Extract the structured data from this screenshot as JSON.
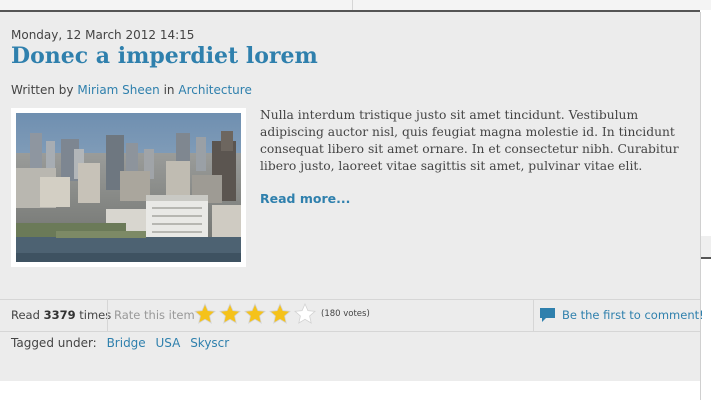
{
  "article": {
    "date": "Monday, 12 March 2012 14:15",
    "title": "Donec a imperdiet lorem",
    "written_by_label": "Written by",
    "author": "Miriam Sheen",
    "in_label": "in",
    "category": "Architecture",
    "intro": "Nulla interdum tristique justo sit amet tincidunt. Vestibulum adipiscing auctor nisl, quis feugiat magna molestie id. In tincidunt consequat libero sit amet ornare. In et consectetur nibh. Curabitur libero justo, laoreet vitae sagittis sit amet, pulvinar vitae elit.",
    "read_more": "Read more..."
  },
  "meta": {
    "read_label": "Read",
    "hits": "3379",
    "times_label": "times",
    "rate_label": "Rate this item",
    "rating": {
      "value": 4,
      "max": 5
    },
    "votes": "(180 votes)",
    "comment_link": "Be the first to comment!"
  },
  "tags": {
    "label": "Tagged under:",
    "items": [
      "Bridge",
      "USA",
      "Skyscr"
    ]
  },
  "colors": {
    "link": "#2f80ad",
    "star_on": "#f5c21b",
    "star_off": "#ffffff"
  }
}
